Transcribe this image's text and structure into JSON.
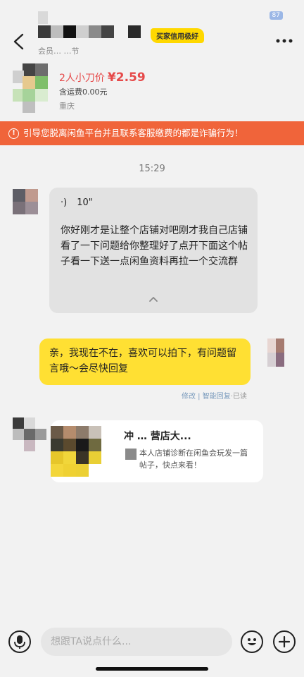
{
  "status": {
    "battery": "87"
  },
  "header": {
    "badge": "买家信用极好",
    "subtitle": "会员…   …节"
  },
  "product": {
    "price_label": "2人小刀价",
    "price": "¥2.59",
    "shipping": "含运费0.00元",
    "location": "重庆"
  },
  "warning": {
    "icon": "!",
    "text": "引导您脱离闲鱼平台并且联系客服缴费的都是诈骗行为！"
  },
  "chat": {
    "time": "15:29",
    "incoming": {
      "voice_icon": "·)",
      "voice_duration": "10\"",
      "text": "你好刚才是让整个店铺对吧刚才我自己店铺看了一下问题给你整理好了点开下面这个帖子看一下送一点闲鱼资料再拉一个交流群"
    },
    "outgoing": {
      "text": "亲，我现在不在，喜欢可以拍下，有问题留言哦～会尽快回复",
      "edit": "修改",
      "separator": " | ",
      "auto": "智能回复",
      "read": "·已读"
    },
    "card": {
      "title": "冲          …   营店大...",
      "desc": "本人店铺诊断在闲鱼会玩发一篇帖子，快点来看！"
    }
  },
  "input": {
    "placeholder": "想跟TA说点什么..."
  },
  "icons": {
    "back": "chevron-left-icon",
    "more": "more-icon",
    "mic": "microphone-icon",
    "emoji": "emoji-icon",
    "plus": "plus-icon"
  },
  "colors": {
    "accent_yellow": "#ffe033",
    "warning_orange": "#f0643a",
    "price_red": "#e64a4a",
    "badge_yellow": "#ffd800"
  }
}
